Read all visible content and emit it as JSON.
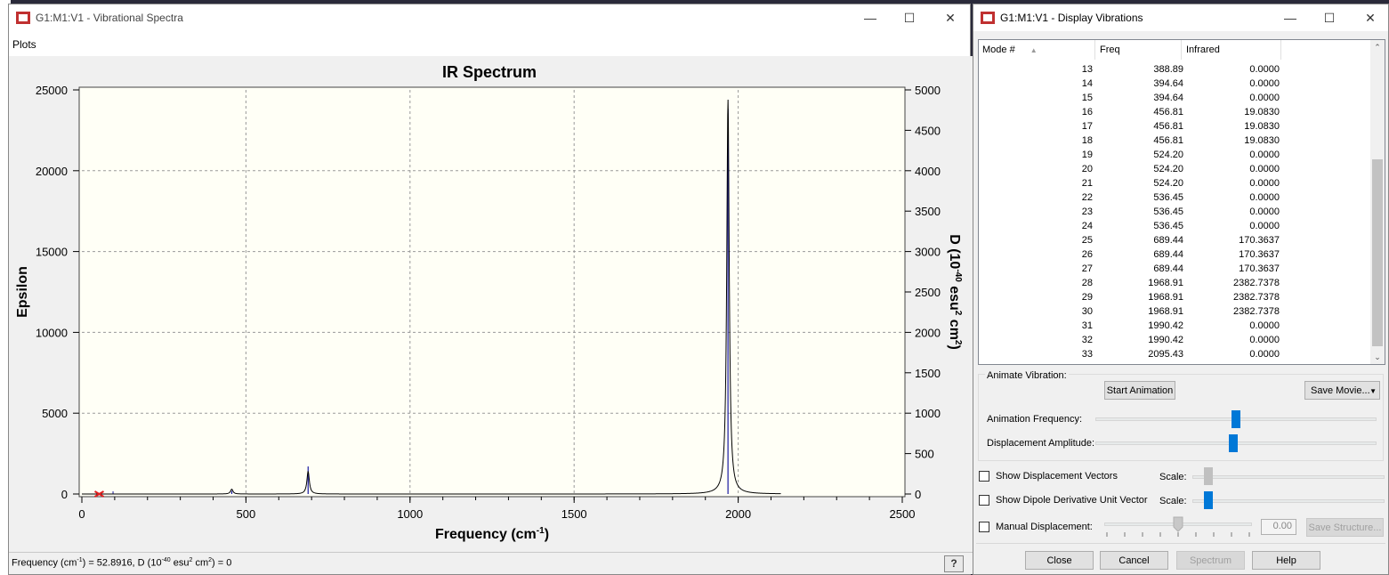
{
  "spectra_window": {
    "title": "G1:M1:V1 - Vibrational Spectra",
    "menu": [
      "Plots"
    ],
    "status": "Frequency (cm-1) = 52.8916, D (10-40 esu2 cm2) = 0",
    "status_parts": {
      "a": "Frequency (cm",
      "b": "-1",
      "c": ") = 52.8916, D (10",
      "d": "-40",
      "e": " esu",
      "f": "2",
      "g": " cm",
      "h": "2",
      "i": ") = 0"
    }
  },
  "vib_window": {
    "title": "G1:M1:V1 - Display Vibrations",
    "columns": [
      "Mode #",
      "Freq",
      "Infrared"
    ],
    "rows": [
      [
        "13",
        "388.89",
        "0.0000"
      ],
      [
        "14",
        "394.64",
        "0.0000"
      ],
      [
        "15",
        "394.64",
        "0.0000"
      ],
      [
        "16",
        "456.81",
        "19.0830"
      ],
      [
        "17",
        "456.81",
        "19.0830"
      ],
      [
        "18",
        "456.81",
        "19.0830"
      ],
      [
        "19",
        "524.20",
        "0.0000"
      ],
      [
        "20",
        "524.20",
        "0.0000"
      ],
      [
        "21",
        "524.20",
        "0.0000"
      ],
      [
        "22",
        "536.45",
        "0.0000"
      ],
      [
        "23",
        "536.45",
        "0.0000"
      ],
      [
        "24",
        "536.45",
        "0.0000"
      ],
      [
        "25",
        "689.44",
        "170.3637"
      ],
      [
        "26",
        "689.44",
        "170.3637"
      ],
      [
        "27",
        "689.44",
        "170.3637"
      ],
      [
        "28",
        "1968.91",
        "2382.7378"
      ],
      [
        "29",
        "1968.91",
        "2382.7378"
      ],
      [
        "30",
        "1968.91",
        "2382.7378"
      ],
      [
        "31",
        "1990.42",
        "0.0000"
      ],
      [
        "32",
        "1990.42",
        "0.0000"
      ],
      [
        "33",
        "2095.43",
        "0.0000"
      ]
    ],
    "animate_label": "Animate Vibration:",
    "start_animation": "Start Animation",
    "save_movie": "Save Movie...",
    "anim_freq_label": "Animation Frequency:",
    "anim_freq_value": 0.5,
    "disp_amp_label": "Displacement Amplitude:",
    "disp_amp_value": 0.49,
    "show_disp_vectors": "Show Displacement Vectors",
    "show_dipole": "Show Dipole Derivative Unit Vector",
    "manual_disp": "Manual Displacement:",
    "scale_label": "Scale:",
    "manual_value": "0.00",
    "save_structure": "Save Structure...",
    "close": "Close",
    "cancel": "Cancel",
    "spectrum": "Spectrum",
    "help": "Help"
  },
  "chart_data": {
    "type": "line",
    "title": "IR Spectrum",
    "xlabel": "Frequency (cm-1)",
    "ylabel": "Epsilon",
    "y2label": "D (10-40 esu2 cm2)",
    "xlim": [
      0,
      2500
    ],
    "ylim": [
      0,
      25000
    ],
    "y2lim": [
      0,
      5000
    ],
    "xticks": [
      "0",
      "500",
      "1000",
      "1500",
      "2000",
      "2500"
    ],
    "yticks": [
      "0",
      "5000",
      "10000",
      "15000",
      "20000",
      "25000"
    ],
    "y2ticks": [
      "0",
      "500",
      "1000",
      "1500",
      "2000",
      "2500",
      "3000",
      "3500",
      "4000",
      "4500",
      "5000"
    ],
    "grid": true,
    "sticks": [
      {
        "x": 456.81,
        "d": 19.083
      },
      {
        "x": 689.44,
        "d": 170.36
      },
      {
        "x": 1968.91,
        "d": 2382.74
      }
    ],
    "spectrum_peaks": [
      {
        "x": 456.81,
        "epsilon": 300
      },
      {
        "x": 689.44,
        "epsilon": 1400
      },
      {
        "x": 1968.91,
        "epsilon": 24400
      }
    ],
    "marker_x": 52.8916,
    "colors": {
      "background": "#fffff6",
      "spectrum": "#000000",
      "sticks": "#1a1aa0",
      "marker": "#e02020"
    }
  }
}
